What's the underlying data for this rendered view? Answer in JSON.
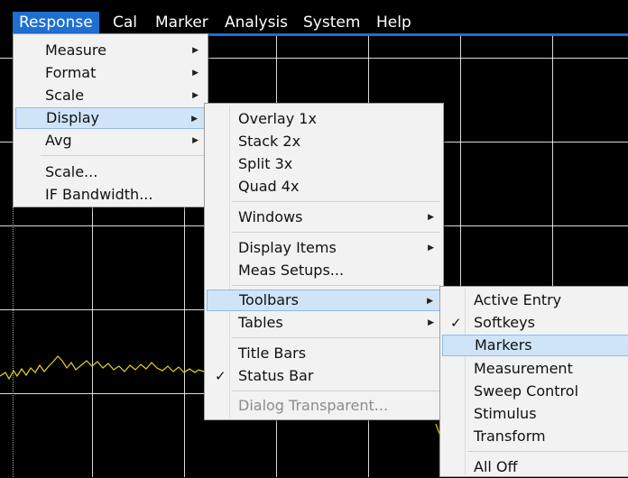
{
  "menubar": {
    "items": [
      "Response",
      "Cal",
      "Marker",
      "Analysis",
      "System",
      "Help"
    ]
  },
  "response_menu": {
    "items": [
      {
        "label": "Measure",
        "submenu": true
      },
      {
        "label": "Format",
        "submenu": true
      },
      {
        "label": "Scale",
        "submenu": true
      },
      {
        "label": "Display",
        "submenu": true,
        "highlighted": true
      },
      {
        "label": "Avg",
        "submenu": true
      },
      {
        "label": "Scale...",
        "submenu": false
      },
      {
        "label": "IF Bandwidth...",
        "submenu": false
      }
    ]
  },
  "display_menu": {
    "items": [
      {
        "label": "Overlay 1x"
      },
      {
        "label": "Stack 2x"
      },
      {
        "label": "Split 3x"
      },
      {
        "label": "Quad 4x"
      },
      {
        "label": "Windows",
        "submenu": true
      },
      {
        "label": "Display Items",
        "submenu": true
      },
      {
        "label": "Meas Setups..."
      },
      {
        "label": "Toolbars",
        "submenu": true,
        "highlighted": true
      },
      {
        "label": "Tables",
        "submenu": true
      },
      {
        "label": "Title Bars"
      },
      {
        "label": "Status Bar",
        "checked": true
      },
      {
        "label": "Dialog Transparent...",
        "disabled": true
      }
    ]
  },
  "toolbars_menu": {
    "items": [
      {
        "label": "Active Entry"
      },
      {
        "label": "Softkeys",
        "checked": true
      },
      {
        "label": "Markers",
        "highlighted": true
      },
      {
        "label": "Measurement"
      },
      {
        "label": "Sweep Control"
      },
      {
        "label": "Stimulus"
      },
      {
        "label": "Transform"
      },
      {
        "label": "All Off"
      }
    ]
  },
  "glyphs": {
    "arrow": "▶",
    "check": "✓"
  },
  "colors": {
    "background": "#000000",
    "accent": "#1f6fd1",
    "trace": "#e6d21a",
    "menu_bg": "#f2f2f2",
    "highlight": "#cfe4f7"
  }
}
